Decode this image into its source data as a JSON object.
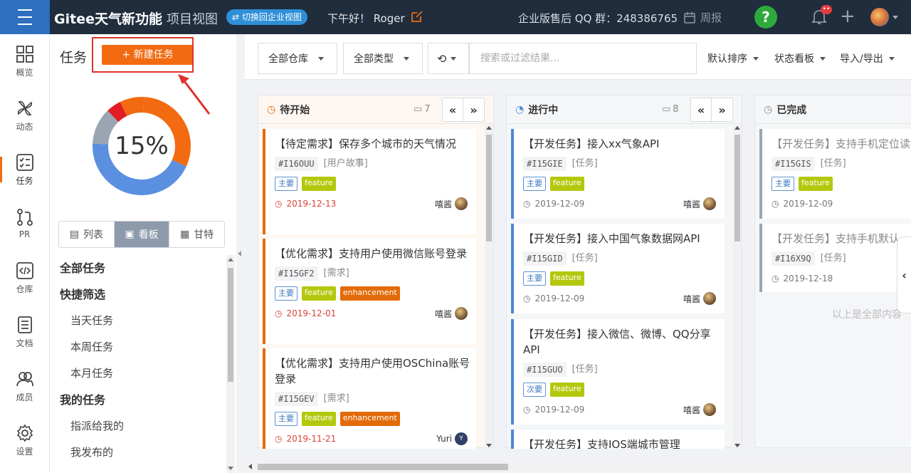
{
  "topbar": {
    "brand": "Gitee天气新功能",
    "brand_sub": "项目视图",
    "switch_label": "⇄ 切换回企业视图",
    "greeting": "下午好！ Roger",
    "qq_group": "企业版售后 QQ 群：248386765",
    "weekly_label": "周报",
    "help_label": "?",
    "bell_badge": "••"
  },
  "leftnav": [
    {
      "label": "概览",
      "icon": "grid-icon"
    },
    {
      "label": "动态",
      "icon": "pinwheel-icon"
    },
    {
      "label": "任务",
      "icon": "tasklist-icon",
      "active": true
    },
    {
      "label": "PR",
      "icon": "pull-request-icon"
    },
    {
      "label": "仓库",
      "icon": "code-icon"
    },
    {
      "label": "文档",
      "icon": "document-icon"
    },
    {
      "label": "成员",
      "icon": "members-icon"
    },
    {
      "label": "设置",
      "icon": "gear-icon"
    }
  ],
  "taskpanel": {
    "title": "任务",
    "new_task": "+ 新建任务",
    "progress_label": "15%",
    "progress_segments": [
      {
        "name": "orange",
        "color": "#f26b11",
        "fraction": 0.31
      },
      {
        "name": "blue",
        "color": "#5b8fe0",
        "fraction": 0.44
      },
      {
        "name": "gray",
        "color": "#9aa5b1",
        "fraction": 0.12
      },
      {
        "name": "red",
        "color": "#e01e24",
        "fraction": 0.05
      },
      {
        "name": "orange2",
        "color": "#f26b11",
        "fraction": 0.08
      }
    ],
    "view_tabs": [
      "列表",
      "看板",
      "甘特"
    ],
    "active_view": "看板",
    "filters": {
      "all_tasks": "全部任务",
      "quick_filter": "快捷筛选",
      "today": "当天任务",
      "week": "本周任务",
      "month": "本月任务",
      "my_tasks": "我的任务",
      "assigned": "指派给我的",
      "published": "我发布的"
    }
  },
  "toolbar": {
    "repo_select": "全部仓库",
    "type_select": "全部类型",
    "search_placeholder": "搜索或过滤结果...",
    "sort": "默认排序",
    "board": "状态看板",
    "import_export": "导入/导出"
  },
  "columns": [
    {
      "title": "待开始",
      "count": "7",
      "accent": "#e36b0a",
      "cards": [
        {
          "title": "【待定需求】保存多个城市的天气情况",
          "id": "#I16OUU",
          "type": "[用户故事]",
          "tags": [
            "主要",
            "feature"
          ],
          "date": "2019-12-13",
          "user": "嘻酱",
          "overdue": true
        },
        {
          "title": "【优化需求】支持用户使用微信账号登录",
          "id": "#I15GF2",
          "type": "[需求]",
          "tags": [
            "主要",
            "feature",
            "enhancement"
          ],
          "date": "2019-12-01",
          "user": "嘻酱",
          "overdue": true
        },
        {
          "title": "【优化需求】支持用户使用OSChina账号登录",
          "id": "#I15GEV",
          "type": "[需求]",
          "tags": [
            "主要",
            "feature",
            "enhancement"
          ],
          "date": "2019-11-21",
          "user": "Yuri",
          "overdue": true
        }
      ]
    },
    {
      "title": "进行中",
      "count": "8",
      "accent": "#4a8ad8",
      "cards": [
        {
          "title": "【开发任务】接入xx气象API",
          "id": "#I15GIE",
          "type": "[任务]",
          "tags": [
            "主要",
            "feature"
          ],
          "date": "2019-12-09",
          "user": "嘻酱"
        },
        {
          "title": "【开发任务】接入中国气象数据网API",
          "id": "#I15GID",
          "type": "[任务]",
          "tags": [
            "主要",
            "feature"
          ],
          "date": "2019-12-09",
          "user": "嘻酱"
        },
        {
          "title": "【开发任务】接入微信、微博、QQ分享API",
          "id": "#I15GUO",
          "type": "[任务]",
          "tags": [
            "次要",
            "feature"
          ],
          "date": "2019-12-09",
          "user": "嘻酱"
        },
        {
          "title": "【开发任务】支持IOS端城市管理",
          "id": "",
          "type": "",
          "tags": [],
          "date": "",
          "user": ""
        }
      ]
    },
    {
      "title": "已完成",
      "count": "",
      "accent": "#9aa5b1",
      "cards": [
        {
          "title": "【开发任务】支持手机定位读",
          "id": "#I15GIS",
          "type": "[任务]",
          "tags": [
            "主要",
            "feature"
          ],
          "date": "2019-12-09",
          "user": ""
        },
        {
          "title": "【开发任务】支持手机默认",
          "id": "#I16X9Q",
          "type": "[任务]",
          "tags": [],
          "date": "2019-12-18",
          "user": ""
        }
      ],
      "end_text": "以上是全部内容"
    }
  ]
}
